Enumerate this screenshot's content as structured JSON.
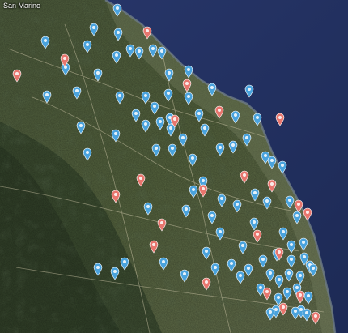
{
  "map": {
    "place_label": "San Marino",
    "colors": {
      "sea": "#23305e",
      "coast": "#6e7c86",
      "land_light": "#5b6a48",
      "land_dark": "#2f3d26",
      "pin_blue": "#4aa3dd",
      "pin_red": "#e8766e",
      "pin_stroke": "#ffffff"
    },
    "pin_count_blue": 92,
    "pin_count_red": 23
  }
}
